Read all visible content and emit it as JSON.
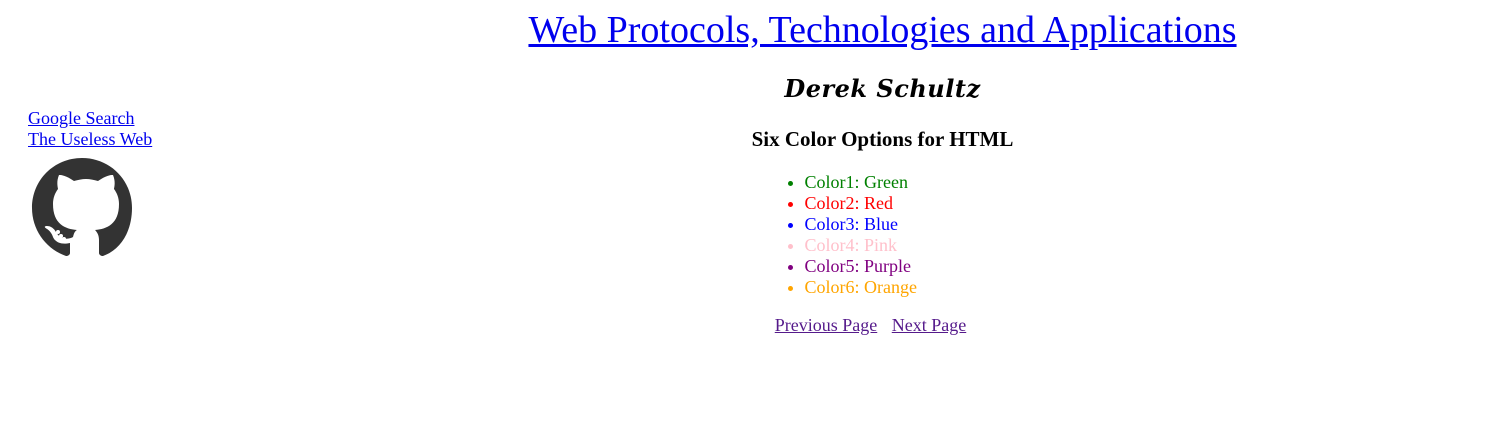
{
  "header": {
    "title": "Web Protocols, Technologies and Applications",
    "author": "Derek Schultz"
  },
  "sidebar": {
    "links": [
      {
        "label": "Google Search"
      },
      {
        "label": "The Useless Web"
      }
    ],
    "logo_icon": "github-icon"
  },
  "main": {
    "heading": "Six Color Options for HTML",
    "colors": [
      {
        "label": "Color1: Green",
        "color": "#008000"
      },
      {
        "label": "Color2: Red",
        "color": "#ff0000"
      },
      {
        "label": "Color3: Blue",
        "color": "#0000ff"
      },
      {
        "label": "Color4: Pink",
        "color": "#ffc0cb"
      },
      {
        "label": "Color5: Purple",
        "color": "#800080"
      },
      {
        "label": "Color6: Orange",
        "color": "#ffa500"
      }
    ]
  },
  "pager": {
    "previous_label": "Previous Page",
    "next_label": "Next Page"
  }
}
